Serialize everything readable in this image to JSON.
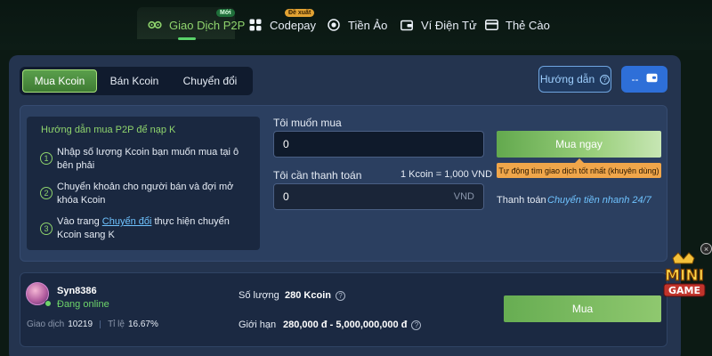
{
  "nav": {
    "items": [
      {
        "label": "Giao Dịch P2P",
        "icon": "handshake-icon",
        "badge": "Mới",
        "active": true
      },
      {
        "label": "Codepay",
        "icon": "grid-icon",
        "badge": "Đề xuất"
      },
      {
        "label": "Tiền Ảo",
        "icon": "coin-icon"
      },
      {
        "label": "Ví Điện Tử",
        "icon": "wallet-icon"
      },
      {
        "label": "Thẻ Cào",
        "icon": "card-icon"
      }
    ]
  },
  "tabs": {
    "buy": "Mua Kcoin",
    "sell": "Bán Kcoin",
    "convert": "Chuyển đổi",
    "active": "buy"
  },
  "header_buttons": {
    "guide": "Hướng dẫn",
    "wallet": "--"
  },
  "guide": {
    "title": "Hướng dẫn mua P2P để nạp K",
    "steps": [
      {
        "num": "1",
        "text": "Nhập số lượng Kcoin bạn muốn mua tại ô bên phải"
      },
      {
        "num": "2",
        "text": "Chuyển khoản cho người bán và đợi mở khóa Kcoin"
      },
      {
        "num": "3",
        "text_before": "Vào trang ",
        "link": "Chuyển đổi",
        "text_after": " thực hiện chuyển Kcoin sang K"
      }
    ]
  },
  "form": {
    "want_buy_label": "Tôi muốn mua",
    "want_buy_value": "0",
    "need_pay_label": "Tôi cần thanh toán",
    "rate": "1 Kcoin = 1,000 VND",
    "need_pay_value": "0",
    "unit": "VND"
  },
  "buy_now": {
    "label": "Mua ngay",
    "tooltip": "Tự động tìm giao dịch tốt nhất (khuyên dùng)",
    "pay_label": "Thanh toán",
    "pay_value": "Chuyển tiền nhanh 24/7"
  },
  "seller": {
    "name": "Syn8386",
    "status": "Đang online",
    "trades_label": "Giao dịch",
    "trades_value": "10219",
    "rate_label": "Tỉ lệ",
    "rate_value": "16.67%",
    "qty_label": "Số lượng",
    "qty_value": "280 Kcoin",
    "limit_label": "Giới hạn",
    "limit_value": "280,000 đ - 5,000,000,000 đ",
    "buy_label": "Mua"
  },
  "logo": {
    "text_line1": "MINI",
    "text_line2": "GAME"
  },
  "colors": {
    "accent_green": "#5ad36a",
    "panel": "#24344f",
    "link": "#6fc3ff",
    "tooltip": "#f0a64a",
    "wallet_button": "#2e6fd8"
  }
}
